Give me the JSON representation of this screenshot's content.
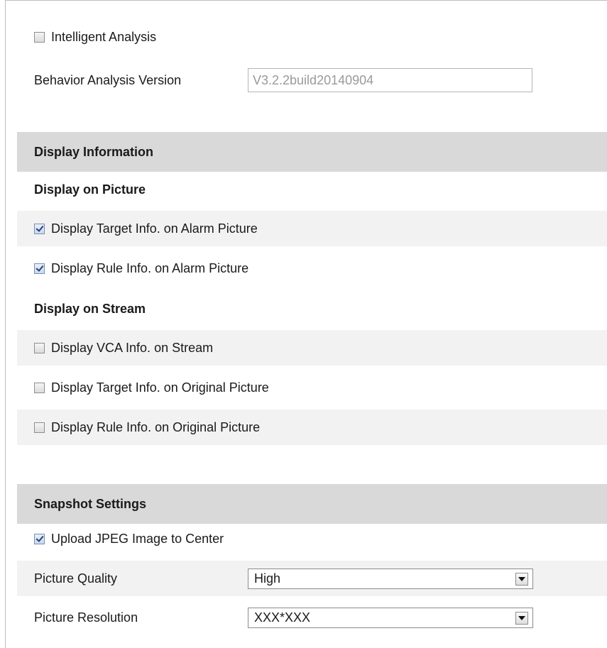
{
  "intelligent": {
    "label": "Intelligent Analysis",
    "checked": false
  },
  "version": {
    "label": "Behavior Analysis Version",
    "value": "V3.2.2build20140904"
  },
  "display": {
    "header": "Display Information",
    "picture_heading": "Display on Picture",
    "picture_items": [
      {
        "label": "Display Target Info. on Alarm Picture",
        "checked": true
      },
      {
        "label": "Display Rule Info. on Alarm Picture",
        "checked": true
      }
    ],
    "stream_heading": "Display on Stream",
    "stream_items": [
      {
        "label": "Display VCA Info. on Stream",
        "checked": false
      },
      {
        "label": "Display Target Info. on Original Picture",
        "checked": false
      },
      {
        "label": "Display Rule Info. on Original Picture",
        "checked": false
      }
    ]
  },
  "snapshot": {
    "header": "Snapshot Settings",
    "upload": {
      "label": "Upload JPEG Image to Center",
      "checked": true
    },
    "quality": {
      "label": "Picture Quality",
      "value": "High"
    },
    "resolution": {
      "label": "Picture Resolution",
      "value": "XXX*XXX"
    }
  }
}
